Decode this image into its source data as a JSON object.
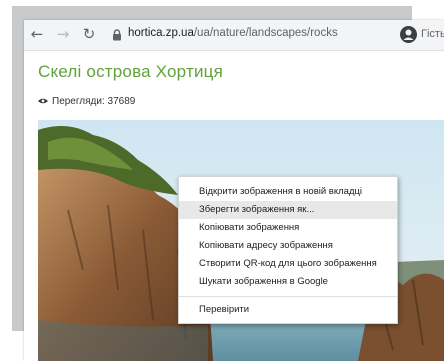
{
  "browser": {
    "url_host": "hortica.zp.ua",
    "url_path": "/ua/nature/landscapes/rocks",
    "profile_label": "Гість",
    "icons": {
      "back": "arrow-left-icon",
      "forward": "arrow-right-icon",
      "reload": "reload-icon",
      "lock": "lock-icon",
      "profile": "profile-icon"
    }
  },
  "page": {
    "title": "Скелі острова Хортиця",
    "views_label": "Перегляди: 37689",
    "icons": {
      "views": "eye-icon"
    }
  },
  "context_menu": {
    "items": [
      "Відкрити зображення в новій вкладці",
      "Зберегти зображення як...",
      "Копіювати зображення",
      "Копіювати адресу зображення",
      "Створити QR-код для цього зображення",
      "Шукати зображення в Google",
      "Перевірити"
    ],
    "hovered_index": 1
  },
  "colors": {
    "title_green": "#5fa33a",
    "menu_hover": "#e8e8e9",
    "backdrop_grey": "#c7c9cb"
  }
}
